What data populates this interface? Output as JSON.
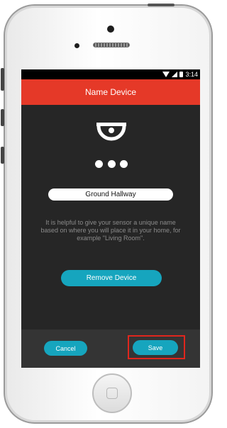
{
  "status_bar": {
    "time": "3:14"
  },
  "app_bar": {
    "title": "Name Device"
  },
  "device_name": {
    "value": "Ground Hallway"
  },
  "help_text": "It is helpful to give your sensor a unique name based on where you will place it in your home, for example \"Living Room\".",
  "buttons": {
    "remove": "Remove Device",
    "cancel": "Cancel",
    "save": "Save"
  },
  "colors": {
    "accent": "#16a5be",
    "brand": "#e53928",
    "highlight": "#e0261d",
    "background": "#262626"
  },
  "icons": [
    "wifi-icon",
    "signal-icon",
    "battery-icon",
    "sensor-logo-icon"
  ]
}
